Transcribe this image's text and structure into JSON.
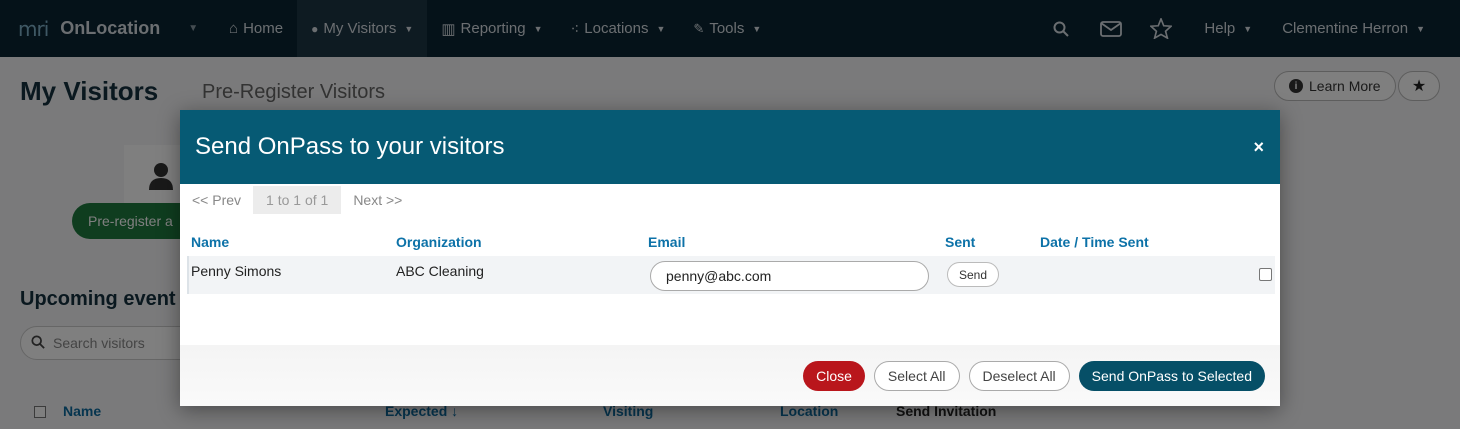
{
  "nav": {
    "logo": "mri",
    "brand": "OnLocation",
    "items": [
      {
        "label": "Home",
        "icon": "home-icon",
        "glyph": "⌂"
      },
      {
        "label": "My Visitors",
        "icon": "person-icon",
        "glyph": "👤"
      },
      {
        "label": "Reporting",
        "icon": "chart-icon",
        "glyph": "▥"
      },
      {
        "label": "Locations",
        "icon": "locations-icon",
        "glyph": "⁖"
      },
      {
        "label": "Tools",
        "icon": "wrench-icon",
        "glyph": "🔧"
      }
    ],
    "help": "Help",
    "user": "Clementine Herron"
  },
  "page": {
    "title": "My Visitors",
    "tab": "Pre-Register Visitors",
    "learn_more": "Learn More",
    "preregister_button": "Pre-register a",
    "upcoming_heading": "Upcoming event",
    "search_placeholder": "Search visitors",
    "columns": [
      "Name",
      "Expected ↓",
      "Visiting",
      "Location",
      "Send Invitation"
    ]
  },
  "modal": {
    "title": "Send OnPass to your visitors",
    "close_glyph": "×",
    "pager": {
      "prev": "<< Prev",
      "range": "1 to 1 of 1",
      "next": "Next >>"
    },
    "headers": {
      "name": "Name",
      "organization": "Organization",
      "email": "Email",
      "sent": "Sent",
      "datetime": "Date / Time Sent"
    },
    "rows": [
      {
        "name": "Penny Simons",
        "organization": "ABC Cleaning",
        "email": "penny@abc.com",
        "send_label": "Send",
        "datetime": ""
      }
    ],
    "buttons": {
      "close": "Close",
      "select_all": "Select All",
      "deselect_all": "Deselect All",
      "send_selected": "Send OnPass to Selected"
    }
  },
  "colors": {
    "nav_bg": "#0b2533",
    "modal_header": "#065a74",
    "close_button": "#b9161c",
    "primary_button": "#064f67",
    "header_text": "#0d72a8"
  }
}
